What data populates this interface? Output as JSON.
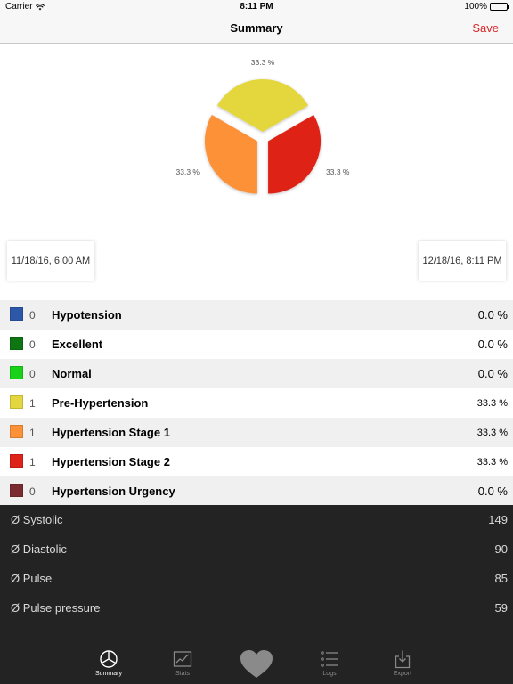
{
  "status_bar": {
    "carrier": "Carrier",
    "time": "8:11 PM",
    "battery": "100%"
  },
  "nav": {
    "title": "Summary",
    "save_label": "Save"
  },
  "chart_data": {
    "type": "pie",
    "slices": [
      {
        "label": "Pre-Hypertension",
        "value": 33.3,
        "display": "33.3 %",
        "color": "#e4d63e"
      },
      {
        "label": "Hypertension Stage 2",
        "value": 33.3,
        "display": "33.3 %",
        "color": "#de2318"
      },
      {
        "label": "Hypertension Stage 1",
        "value": 33.3,
        "display": "33.3 %",
        "color": "#fd9138"
      }
    ]
  },
  "dates": {
    "start": "11/18/16, 6:00 AM",
    "end": "12/18/16, 8:11 PM"
  },
  "categories": [
    {
      "count": "0",
      "name": "Hypotension",
      "pct": "0.0 %",
      "color": "#2d58a8"
    },
    {
      "count": "0",
      "name": "Excellent",
      "pct": "0.0 %",
      "color": "#0d7512"
    },
    {
      "count": "0",
      "name": "Normal",
      "pct": "0.0 %",
      "color": "#18d21a"
    },
    {
      "count": "1",
      "name": "Pre-Hypertension",
      "pct": "33.3 %",
      "color": "#e4d63e"
    },
    {
      "count": "1",
      "name": "Hypertension Stage 1",
      "pct": "33.3 %",
      "color": "#fd9138"
    },
    {
      "count": "1",
      "name": "Hypertension Stage 2",
      "pct": "33.3 %",
      "color": "#de2318"
    },
    {
      "count": "0",
      "name": "Hypertension Urgency",
      "pct": "0.0 %",
      "color": "#7b2b30"
    }
  ],
  "stats": [
    {
      "label": "Ø Systolic",
      "value": "149"
    },
    {
      "label": "Ø Diastolic",
      "value": "90"
    },
    {
      "label": "Ø Pulse",
      "value": "85"
    },
    {
      "label": "Ø Pulse pressure",
      "value": "59"
    }
  ],
  "tabs": [
    {
      "label": "Summary",
      "icon": "pie-chart-icon"
    },
    {
      "label": "Stats",
      "icon": "line-chart-icon"
    },
    {
      "label": "",
      "icon": "heart-icon"
    },
    {
      "label": "Logs",
      "icon": "list-icon"
    },
    {
      "label": "Export",
      "icon": "export-icon"
    }
  ]
}
